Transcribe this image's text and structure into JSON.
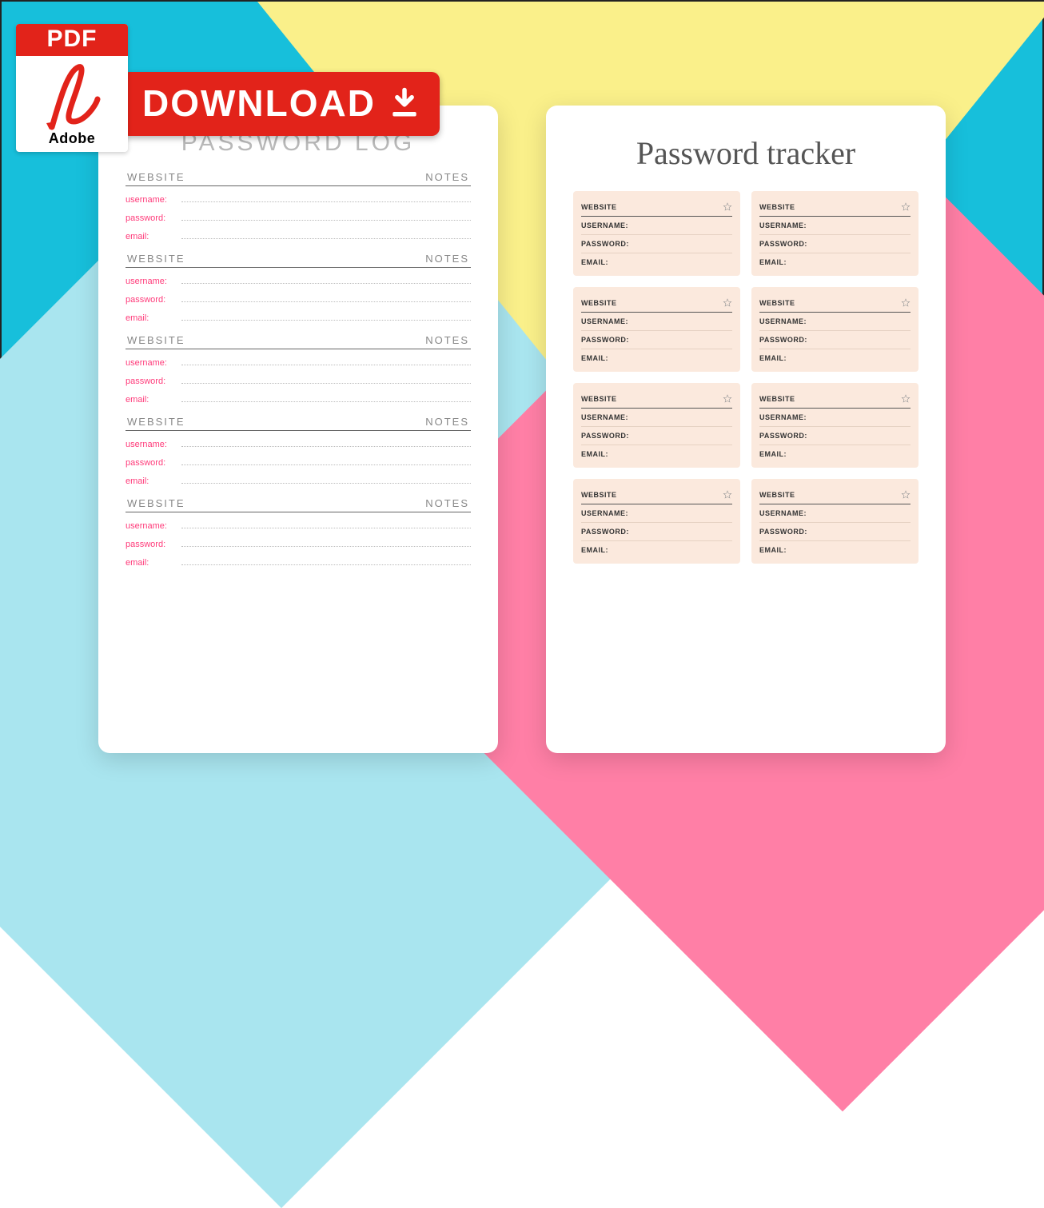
{
  "badge": {
    "pdf": "PDF",
    "adobe": "Adobe",
    "download": "DOWNLOAD"
  },
  "leftPage": {
    "title": "PASSWORD LOG",
    "headWebsite": "WEBSITE",
    "headNotes": "NOTES",
    "labels": {
      "username": "username:",
      "password": "password:",
      "email": "email:"
    },
    "blockCount": 5
  },
  "rightPage": {
    "title": "Password tracker",
    "cardLabels": {
      "website": "WEBSITE",
      "username": "USERNAME:",
      "password": "PASSWORD:",
      "email": "EMAIL:"
    },
    "cardCount": 8
  }
}
